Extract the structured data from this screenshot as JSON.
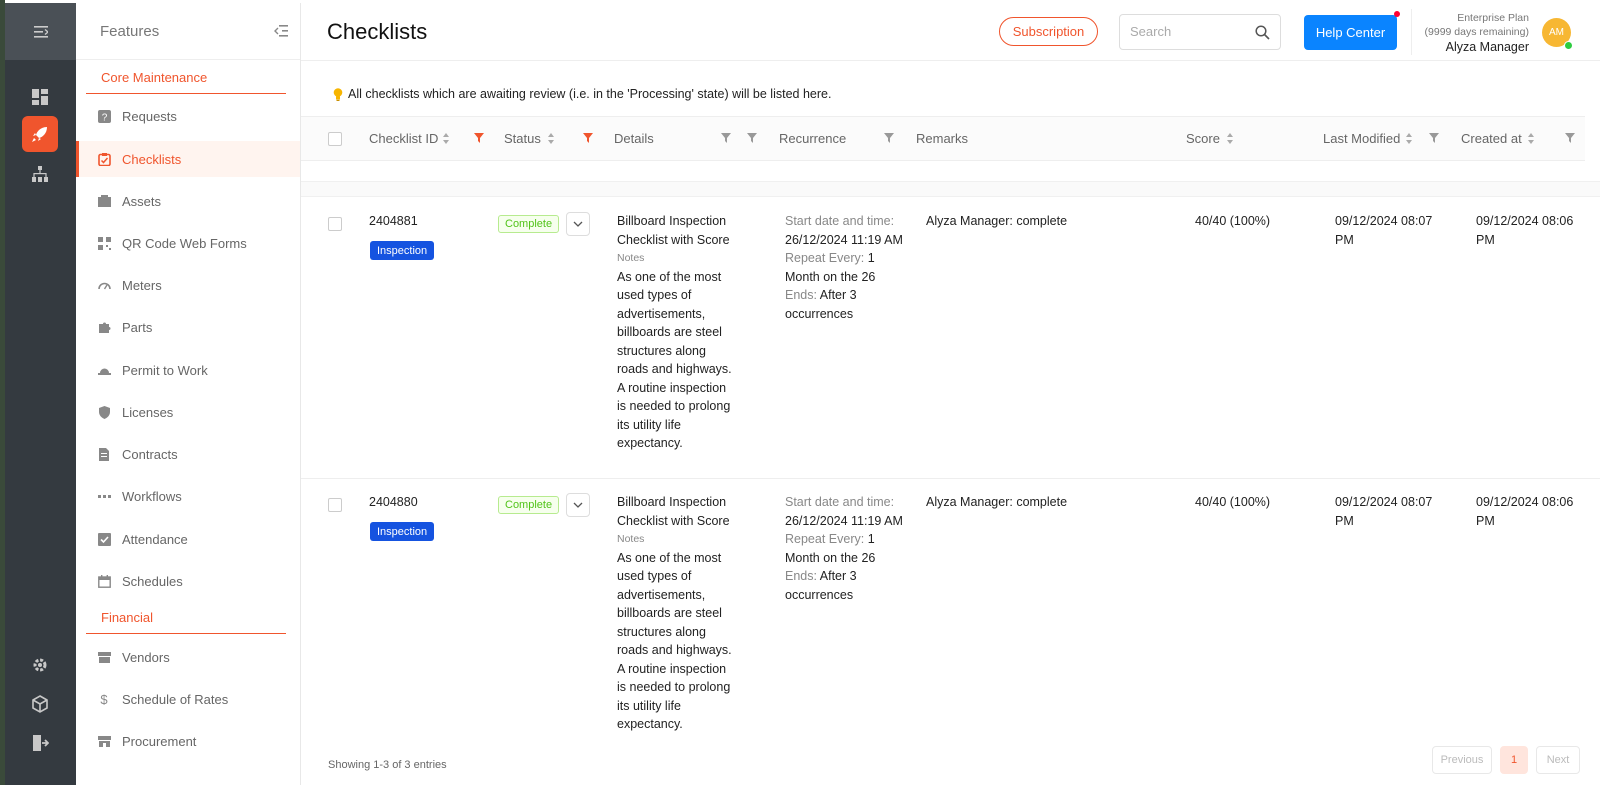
{
  "colors": {
    "accent": "#f0552d",
    "primary_blue": "#0a84ff",
    "badge_blue": "#1553e0",
    "success_green": "#52c41a",
    "rail_bg": "#343a40"
  },
  "rail": {
    "icons": [
      "hamburger-menu-icon",
      "dashboard-icon",
      "rocket-icon",
      "org-chart-icon",
      "settings-icon",
      "cube-icon",
      "logout-icon"
    ]
  },
  "sidebar": {
    "title": "Features",
    "sections": [
      {
        "title": "Core Maintenance"
      },
      {
        "title": "Financial"
      }
    ],
    "items": [
      {
        "label": "Requests",
        "icon": "question-icon"
      },
      {
        "label": "Checklists",
        "icon": "checklist-icon",
        "active": true
      },
      {
        "label": "Assets",
        "icon": "assets-icon"
      },
      {
        "label": "QR Code Web Forms",
        "icon": "qr-code-icon"
      },
      {
        "label": "Meters",
        "icon": "meter-icon"
      },
      {
        "label": "Parts",
        "icon": "puzzle-icon"
      },
      {
        "label": "Permit to Work",
        "icon": "hardhat-icon"
      },
      {
        "label": "Licenses",
        "icon": "shield-icon"
      },
      {
        "label": "Contracts",
        "icon": "contract-icon"
      },
      {
        "label": "Workflows",
        "icon": "workflow-icon"
      },
      {
        "label": "Attendance",
        "icon": "attendance-icon"
      },
      {
        "label": "Schedules",
        "icon": "calendar-icon"
      },
      {
        "label": "Vendors",
        "icon": "store-icon"
      },
      {
        "label": "Schedule of Rates",
        "icon": "dollar-icon"
      },
      {
        "label": "Procurement",
        "icon": "procurement-icon"
      }
    ]
  },
  "header": {
    "title": "Checklists",
    "subscription_label": "Subscription",
    "search_placeholder": "Search",
    "help_label": "Help Center",
    "plan_name": "Enterprise Plan",
    "plan_remaining": "(9999 days remaining)",
    "user_name": "Alyza Manager",
    "avatar_initials": "AM"
  },
  "main": {
    "tip": "All checklists which are awaiting review (i.e. in the 'Processing' state) will be listed here.",
    "columns": {
      "id": "Checklist ID",
      "status": "Status",
      "details": "Details",
      "recurrence": "Recurrence",
      "remarks": "Remarks",
      "score": "Score",
      "last_modified": "Last Modified",
      "created_at": "Created at"
    },
    "rows": [
      {
        "id": "2404881",
        "type": "Inspection",
        "status": "Complete",
        "title": "Billboard Inspection Checklist with Score",
        "notes_label": "Notes",
        "notes": "As one of the most used types of advertisements, billboards are steel structures along roads and highways. A routine inspection is needed to prolong its utility life expectancy.",
        "start_label": "Start date and time:",
        "start_value": "26/12/2024 11:19 AM",
        "repeat_label": "Repeat Every:",
        "repeat_value": "1 Month on the 26",
        "ends_label": "Ends:",
        "ends_value": "After 3 occurrences",
        "remarks": "Alyza Manager: complete",
        "score": "40/40 (100%)",
        "last_modified": "09/12/2024 08:07 PM",
        "created_at": "09/12/2024 08:06 PM"
      },
      {
        "id": "2404880",
        "type": "Inspection",
        "status": "Complete",
        "title": "Billboard Inspection Checklist with Score",
        "notes_label": "Notes",
        "notes": "As one of the most used types of advertisements, billboards are steel structures along roads and highways. A routine inspection is needed to prolong its utility life expectancy.",
        "start_label": "Start date and time:",
        "start_value": "26/12/2024 11:19 AM",
        "repeat_label": "Repeat Every:",
        "repeat_value": "1 Month on the 26",
        "ends_label": "Ends:",
        "ends_value": "After 3 occurrences",
        "remarks": "Alyza Manager: complete",
        "score": "40/40 (100%)",
        "last_modified": "09/12/2024 08:07 PM",
        "created_at": "09/12/2024 08:06 PM"
      }
    ],
    "footer": {
      "showing": "Showing 1-3 of 3 entries",
      "previous": "Previous",
      "page": "1",
      "next": "Next"
    }
  }
}
